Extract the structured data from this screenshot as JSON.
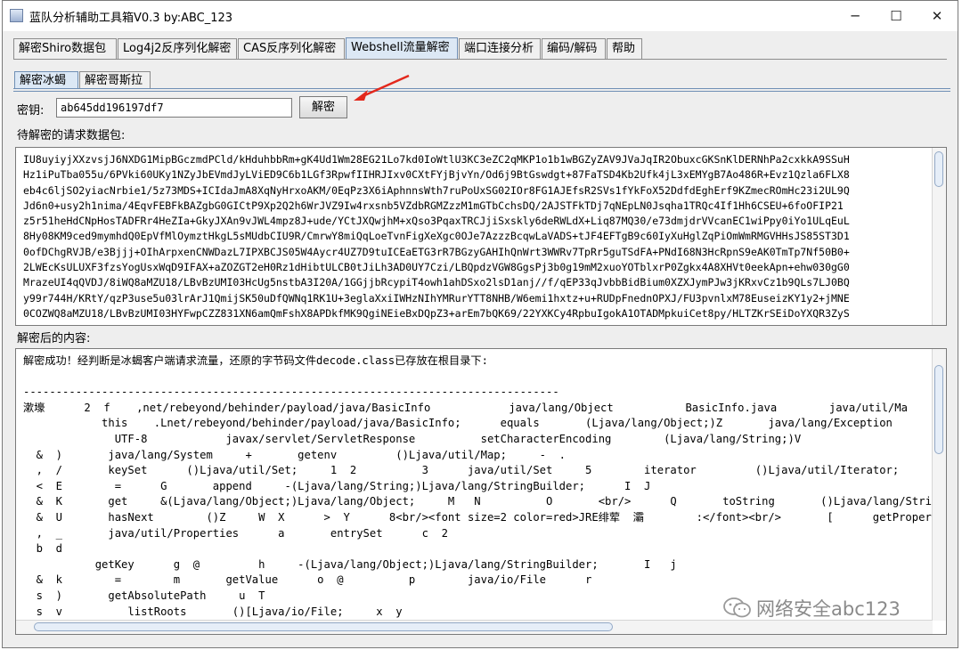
{
  "window": {
    "title": "蓝队分析辅助工具箱V0.3 by:ABC_123",
    "minimize_glyph": "─",
    "maximize_glyph": "☐",
    "close_glyph": "✕"
  },
  "main_tabs": [
    {
      "label": "解密Shiro数据包"
    },
    {
      "label": "Log4j2反序列化解密"
    },
    {
      "label": "CAS反序列化解密"
    },
    {
      "label": "Webshell流量解密"
    },
    {
      "label": "端口连接分析"
    },
    {
      "label": "编码/解码"
    },
    {
      "label": "帮助"
    }
  ],
  "active_main_tab": "Webshell流量解密",
  "sub_tabs": [
    {
      "label": "解密冰蝎"
    },
    {
      "label": "解密哥斯拉"
    }
  ],
  "active_sub_tab": "解密冰蝎",
  "key_label": "密钥:",
  "key_value": "ab645dd196197df7",
  "decrypt_button": "解密",
  "request_label": "待解密的请求数据包:",
  "request_text": "IU8uyiyjXXzvsjJ6NXDG1MipBGczmdPCld/kHduhbbRm+gK4Ud1Wm28EG21Lo7kd0IoWtlU3KC3eZC2qMKP1o1b1wBGZyZAV9JVaJqIR2ObuxcGKSnKlDERNhPa2cxkkA9SSuH\nHz1iPuTba055u/6PVki60UKy1NZyJbEVmdJyLViED9C6b1LGf3RpwfIIHRJIxv0CXtFYjBjvYn/Od6j9BtGswdgt+87FaTSD4Kb2Ufk4jL3xEMYgB7Ao486R+Evz1Qzla6FLX8\neb4c6ljSO2yiacNrbie1/5z73MDS+ICIdaJmA8XqNyHrxoAKM/0EqPz3X6iAphnnsWth7ruPoUxSG02IOr8FG1AJEfsR2SVs1fYkFoX52DdfdEghErf9KZmecROmHc23i2UL9Q\nJd6n0+usy2h1nima/4EqvFEBFkBAZgbG0GICtP9Xp2Q2h6WrJVZ9Iw4rxsnb5VZdbRGMZzzM1mGTbCchsDQ/2AJSTFkTDj7qNEpLN0Jsqha1TRQc4If1Hh6CSEU+6foOFIP21\nz5r51heHdCNpHosTADFRr4HeZIa+GkyJXAn9vJWL4mpz8J+ude/YCtJXQwjhM+xQso3PqaxTRCJjiSxskly6deRWLdX+Liq87MQ30/e73dmjdrVVcanEC1wiPpy0iYo1ULqEuL\n8Hy08KM9ced9mymhdQ0EpVfMlOymztHkgL5sMUdbCIU9R/CmrwY8miQqLoeTvnFigXeXgc0OJe7AzzzBcqwLaVADS+tJF4EFTgB9c60IyXuHglZqPiOmWmRMGVHHsJS85ST3D1\n0ofDChgRVJB/e3Bjjj+OIhArpxenCNWDazL7IPXBCJS05W4Aycr4UZ7D9tuICEaETG3rR7BGzyGAHIhQnWrt3WWRv7TpRr5guTSdFA+PNdI68N3HcRpnS9eAK0TmTp7Nf50B0+\n2LWEcKsULUXF3fzsYogUsxWqD9IFAX+aZOZGT2eH0Rz1dHibtULCB0tJiLh3AD0UY7Czi/LBQpdzVGW8GgsPj3b0g19mM2xuoYOTblxrP0Zgkx4A8XHVt0eekApn+ehw030gG0\nMrazeUI4qQVDJ/8iWQ8aMZU18/LBvBzUMI03HcUg5nstbA3I20A/1GGjjbRcypiT4owh1ahDSxo2lsD1anj//f/qEP33qJvbbBidBium0XZXJymPJw3jKRxvCz1b9QLs7LJ0BQ\ny99r744H/KRtY/qzP3use5u03lrArJ1QmijSK50uDfQWNq1RK1U+3eglaXxiIWHzNIhYMRurYTT8NHB/W6emi1hxtz+u+RUDpFnednOPXJ/FU3pvnlxM78EuseizKY1y2+jMNE\n0COZWQ8aMZU18/LBvBzUMI03HYFwpCZZ831XN6amQmFshX8APDkfMK9QgiNEieBxDQpZ3+arEm7bQK69/22YXKCy4RpbuIgokA1OTADMpkuiCet8py/HLTZKrSEiDoYXQR3ZyS",
  "result_label": "解密后的内容:",
  "result_text": "解密成功！经判断是冰蝎客户端请求流量，还原的字节码文件decode.class已存放在根目录下:\n\n----------------------------------------------------------------------------------\n漱壕      2  f    ,net/rebeyond/behinder/payload/java/BasicInfo            java/lang/Object           BasicInfo.java        java/util/Ma\n            this    .Lnet/rebeyond/behinder/payload/java/BasicInfo;      equals       (Ljava/lang/Object;)Z       java/lang/Exception\n              UTF-8            javax/servlet/ServletResponse          setCharacterEncoding        (Ljava/lang/String;)V\n  &  )       java/lang/System     +       getenv         ()Ljava/util/Map;     -  .\n  ,  /       keySet      ()Ljava/util/Set;     1  2          3      java/util/Set     5        iterator         ()Ljava/util/Iterator;     7  8\n  <  E        =      G       append     -(Ljava/lang/String;)Ljava/lang/StringBuilder;      I  J\n  &  K       get     &(Ljava/lang/Object;)Ljava/lang/Object;     M   N          O       <br/>      Q       toString       ()Ljava/lang/String;\n  &  U       hasNext        ()Z     W  X      >  Y      8<br/><font size=2 color=red>JRE绯荤  灞        :</font><br/>       [      getProperties\n  ,  _       java/util/Properties      a       entrySet      c  2\n  b  d\n           getKey      g  @         h     -(Ljava/lang/Object;)Ljava/lang/StringBuilder;       I   j\n  &  k        =        m       getValue      o  @          p        java/io/File      r\n  s  )       getAbsolutePath     u  T\n  s  v          listRoots       ()[Ljava/io/File;     x  y",
  "watermark": {
    "text": "网络安全abc123",
    "icon": "wechat-icon"
  },
  "colors": {
    "active_tab_bg": "#dce8f5",
    "annotation_arrow": "#e3281c",
    "tab_border": "#6f8fb5"
  }
}
